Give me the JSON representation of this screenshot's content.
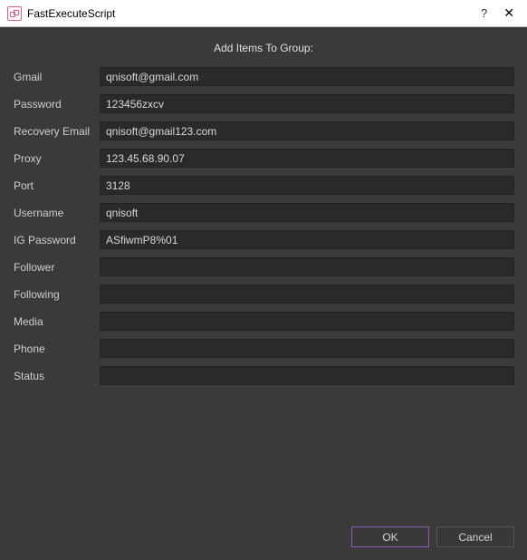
{
  "titlebar": {
    "title": "FastExecuteScript",
    "help": "?",
    "close": "✕"
  },
  "heading": "Add Items To Group:",
  "fields": [
    {
      "label": "Gmail",
      "value": "qnisoft@gmail.com"
    },
    {
      "label": "Password",
      "value": "123456zxcv"
    },
    {
      "label": "Recovery Email",
      "value": "qnisoft@gmail123.com"
    },
    {
      "label": "Proxy",
      "value": "123.45.68.90.07"
    },
    {
      "label": "Port",
      "value": "3128"
    },
    {
      "label": "Username",
      "value": "qnisoft"
    },
    {
      "label": "IG Password",
      "value": "ASfiwmP8%01"
    },
    {
      "label": "Follower",
      "value": ""
    },
    {
      "label": "Following",
      "value": ""
    },
    {
      "label": "Media",
      "value": ""
    },
    {
      "label": "Phone",
      "value": ""
    },
    {
      "label": "Status",
      "value": ""
    }
  ],
  "buttons": {
    "ok": "OK",
    "cancel": "Cancel"
  }
}
